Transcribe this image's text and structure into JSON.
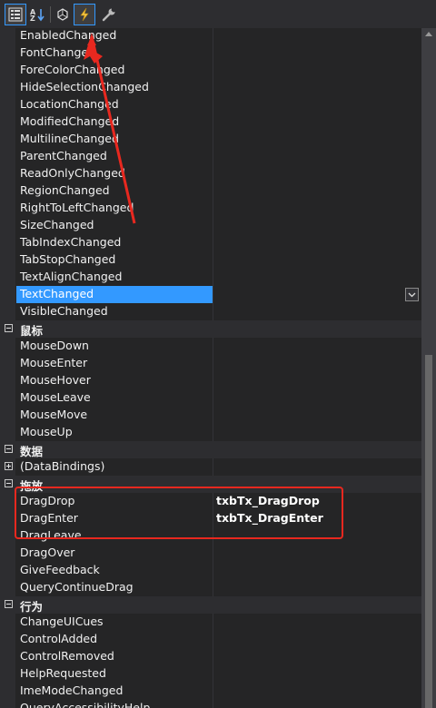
{
  "toolbar": {
    "buttons": [
      {
        "name": "categorized-icon"
      },
      {
        "name": "alphabetical-sort-icon"
      },
      {
        "name": "properties-icon"
      },
      {
        "name": "events-lightning-icon"
      },
      {
        "name": "property-pages-wrench-icon"
      }
    ]
  },
  "rows": [
    {
      "kind": "prop",
      "name": "EnabledChanged",
      "value": ""
    },
    {
      "kind": "prop",
      "name": "FontChanged",
      "value": ""
    },
    {
      "kind": "prop",
      "name": "ForeColorChanged",
      "value": ""
    },
    {
      "kind": "prop",
      "name": "HideSelectionChanged",
      "value": ""
    },
    {
      "kind": "prop",
      "name": "LocationChanged",
      "value": ""
    },
    {
      "kind": "prop",
      "name": "ModifiedChanged",
      "value": ""
    },
    {
      "kind": "prop",
      "name": "MultilineChanged",
      "value": ""
    },
    {
      "kind": "prop",
      "name": "ParentChanged",
      "value": ""
    },
    {
      "kind": "prop",
      "name": "ReadOnlyChanged",
      "value": ""
    },
    {
      "kind": "prop",
      "name": "RegionChanged",
      "value": ""
    },
    {
      "kind": "prop",
      "name": "RightToLeftChanged",
      "value": ""
    },
    {
      "kind": "prop",
      "name": "SizeChanged",
      "value": ""
    },
    {
      "kind": "prop",
      "name": "TabIndexChanged",
      "value": ""
    },
    {
      "kind": "prop",
      "name": "TabStopChanged",
      "value": ""
    },
    {
      "kind": "prop",
      "name": "TextAlignChanged",
      "value": ""
    },
    {
      "kind": "prop",
      "name": "TextChanged",
      "value": "",
      "selected": true
    },
    {
      "kind": "prop",
      "name": "VisibleChanged",
      "value": ""
    },
    {
      "kind": "cat",
      "name": "鼠标",
      "expanded": true
    },
    {
      "kind": "prop",
      "name": "MouseDown",
      "value": ""
    },
    {
      "kind": "prop",
      "name": "MouseEnter",
      "value": ""
    },
    {
      "kind": "prop",
      "name": "MouseHover",
      "value": ""
    },
    {
      "kind": "prop",
      "name": "MouseLeave",
      "value": ""
    },
    {
      "kind": "prop",
      "name": "MouseMove",
      "value": ""
    },
    {
      "kind": "prop",
      "name": "MouseUp",
      "value": ""
    },
    {
      "kind": "cat",
      "name": "数据",
      "expanded": true
    },
    {
      "kind": "sub",
      "name": "(DataBindings)",
      "value": ""
    },
    {
      "kind": "cat",
      "name": "拖放",
      "expanded": true
    },
    {
      "kind": "prop",
      "name": "DragDrop",
      "value": "txbTx_DragDrop"
    },
    {
      "kind": "prop",
      "name": "DragEnter",
      "value": "txbTx_DragEnter"
    },
    {
      "kind": "prop",
      "name": "DragLeave",
      "value": ""
    },
    {
      "kind": "prop",
      "name": "DragOver",
      "value": ""
    },
    {
      "kind": "prop",
      "name": "GiveFeedback",
      "value": ""
    },
    {
      "kind": "prop",
      "name": "QueryContinueDrag",
      "value": ""
    },
    {
      "kind": "cat",
      "name": "行为",
      "expanded": true
    },
    {
      "kind": "prop",
      "name": "ChangeUICues",
      "value": ""
    },
    {
      "kind": "prop",
      "name": "ControlAdded",
      "value": ""
    },
    {
      "kind": "prop",
      "name": "ControlRemoved",
      "value": ""
    },
    {
      "kind": "prop",
      "name": "HelpRequested",
      "value": ""
    },
    {
      "kind": "prop",
      "name": "ImeModeChanged",
      "value": ""
    },
    {
      "kind": "prop",
      "name": "QueryAccessibilityHelp",
      "value": ""
    }
  ],
  "colors": {
    "selection": "#3399ff",
    "annotation": "#e8281f",
    "accent": "#3399ff"
  }
}
